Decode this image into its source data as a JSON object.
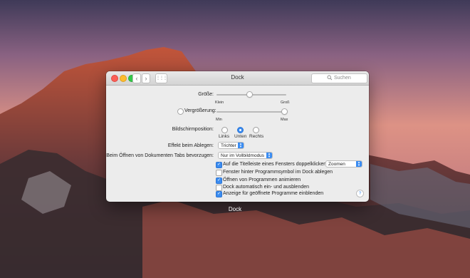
{
  "window": {
    "title": "Dock",
    "search_placeholder": "Suchen",
    "back_glyph": "‹",
    "forward_glyph": "›",
    "grid_glyph": "⋮⋮⋮"
  },
  "groesse": {
    "label": "Größe:",
    "min_label": "Klein",
    "max_label": "Groß",
    "value": 0.47
  },
  "vergroesserung": {
    "label": "Vergrößerung:",
    "checked": false,
    "min_label": "Min",
    "max_label": "Max",
    "value": 0.97
  },
  "bildschirmposition": {
    "label": "Bildschirmposition:",
    "options": [
      "Links",
      "Unten",
      "Rechts"
    ],
    "selected": "Unten"
  },
  "effekt": {
    "label": "Effekt beim Ablegen:",
    "value": "Trichter"
  },
  "tabs": {
    "label": "Beim Öffnen von Dokumenten Tabs bevorzugen:",
    "value": "Nur im Vollbildmodus"
  },
  "checkboxes": [
    {
      "label": "Auf die Titelleiste eines Fensters doppelklicken:",
      "checked": true
    },
    {
      "label": "Fenster hinter Programmsymbol im Dock ablegen",
      "checked": false
    },
    {
      "label": "Öffnen von Programmen animieren",
      "checked": true
    },
    {
      "label": "Dock automatisch ein- und ausblenden",
      "checked": false
    },
    {
      "label": "Anzeige für geöffnete Programme einblenden",
      "checked": true
    }
  ],
  "doppelklick_popup": {
    "value": "Zoomen"
  },
  "help": "?",
  "icons": {
    "search": "search-icon",
    "popup": "chevron-updown-icon",
    "help": "question-icon"
  },
  "colors": {
    "accent": "#3b8cf0"
  },
  "dock_label": "Dock"
}
